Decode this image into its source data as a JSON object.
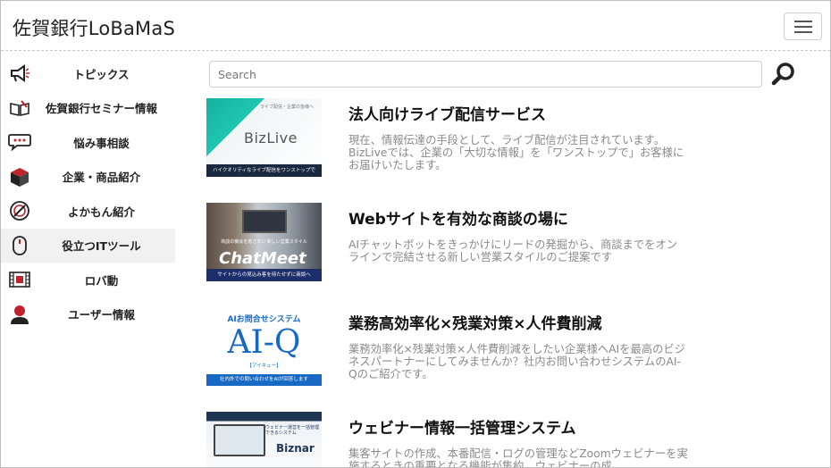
{
  "header": {
    "brand": "佐賀銀行LoBaMaS"
  },
  "sidebar": {
    "items": [
      {
        "label": "トピックス",
        "icon": "megaphone-icon"
      },
      {
        "label": "佐賀銀行セミナー情報",
        "icon": "open-book-icon"
      },
      {
        "label": "悩み事相談",
        "icon": "speech-bubble-icon"
      },
      {
        "label": "企業・商品紹介",
        "icon": "box-icon"
      },
      {
        "label": "よかもん紹介",
        "icon": "food-plate-icon"
      },
      {
        "label": "役立つITツール",
        "icon": "mouse-icon"
      },
      {
        "label": "ロバ動",
        "icon": "film-icon"
      },
      {
        "label": "ユーザー情報",
        "icon": "user-icon"
      }
    ],
    "active_index": 5
  },
  "search": {
    "placeholder": "Search",
    "value": ""
  },
  "articles": [
    {
      "title": "法人向けライブ配信サービス",
      "description": "現在、情報伝達の手段として、ライブ配信が注目されています。BizLiveでは、企業の「大切な情報」を「ワンストップで」お客様にお届けいたします。",
      "thumb": {
        "logo": "BizLive",
        "caption": "ハイクオリティなライブ配信をワンストップで",
        "small_text": "ライブ配信・企業の皆様へ"
      }
    },
    {
      "title": "Webサイトを有効な商談の場に",
      "description": "AIチャットボットをきっかけにリードの発掘から、商談までをオンラインで完結させる新しい営業スタイルのご提案です",
      "thumb": {
        "logo": "ChatMeet",
        "caption": "サイトからの見込み客を待たせずに商談へ",
        "small_text": "商談の機会を逃さない 新しい営業スタイル"
      }
    },
    {
      "title": "業務高効率化×残業対策×人件費削減",
      "description": "業務効率化×残業対策×人件費削減をしたい企業様へAIを最高のビジネスパートナーにしてみませんか？社内お問い合わせシステムのAI-Qのご紹介です。",
      "thumb": {
        "header": "AIお問合せシステム",
        "logo": "AI-Q",
        "reading": "【アイキュー】",
        "caption": "社内外での問い合わせをAIが回答します"
      }
    },
    {
      "title": "ウェビナー情報一括管理システム",
      "description": "集客サイトの作成、本番配信・ログの管理などZoomウェビナーを実施するときの重要となる機能が集約。ウェビナーの成",
      "thumb": {
        "logo": "Biznar",
        "small_text": "ウェビナー運営を一括管理できるシステム"
      }
    }
  ],
  "colors": {
    "accent_teal": "#1fb6a6",
    "ai_q_blue": "#1769c4",
    "biznar_navy": "#1f3554",
    "icon_red": "#c0232c"
  }
}
